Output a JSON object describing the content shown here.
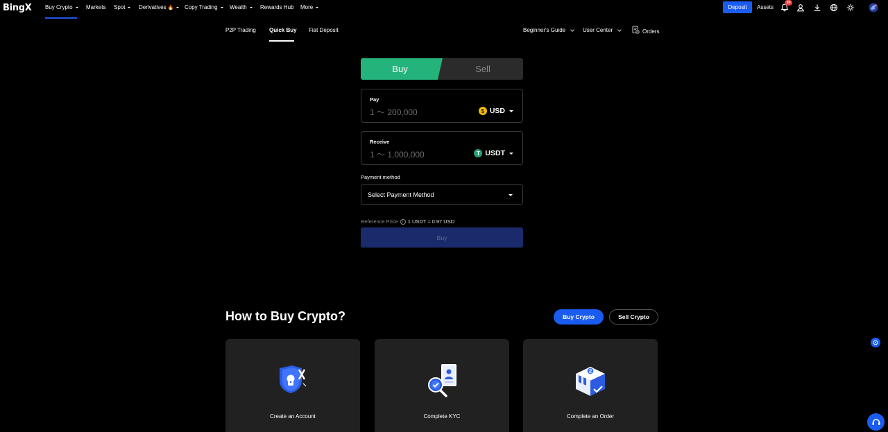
{
  "brand": {
    "logo_text": "BingX"
  },
  "topnav": {
    "items": [
      {
        "label": "Buy Crypto",
        "has_caret": true
      },
      {
        "label": "Markets",
        "has_caret": false
      },
      {
        "label": "Spot",
        "has_caret": true
      },
      {
        "label": "Derivatives",
        "suffix": "🔥",
        "has_caret": true
      },
      {
        "label": "Copy Trading",
        "has_caret": true
      },
      {
        "label": "Wealth",
        "has_caret": true
      },
      {
        "label": "Rewards Hub",
        "has_caret": false
      },
      {
        "label": "More",
        "has_caret": true
      }
    ],
    "active_index": 0,
    "deposit_label": "Deposit",
    "assets_label": "Assets",
    "notification_count": "20",
    "icons": [
      "bell-icon",
      "user-icon",
      "download-icon",
      "globe-icon",
      "theme-sun-icon",
      "avatar"
    ]
  },
  "subnav": {
    "items": [
      "P2P Trading",
      "Quick Buy",
      "Fiat Deposit"
    ],
    "active": "Quick Buy",
    "right": {
      "guide": "Beginner's Guide",
      "user_center": "User Center",
      "orders": "Orders"
    }
  },
  "trade": {
    "buy_tab": "Buy",
    "sell_tab": "Sell",
    "pay": {
      "label": "Pay",
      "placeholder": "1 ～ 200,000",
      "currency": "USD",
      "coin_glyph": "$"
    },
    "receive": {
      "label": "Receive",
      "placeholder": "1 ～ 1,000,000",
      "currency": "USDT",
      "coin_glyph": "T"
    },
    "payment_method": {
      "label": "Payment method",
      "placeholder": "Select Payment Method"
    },
    "reference": {
      "label": "Reference Price",
      "value": "1 USDT ≈ 0.97 USD"
    },
    "submit_label": "Buy"
  },
  "how_to": {
    "title": "How to Buy Crypto?",
    "buy_button": "Buy Crypto",
    "sell_button": "Sell Crypto",
    "steps": [
      "Create an Account",
      "Complete KYC",
      "Complete an Order"
    ]
  },
  "colors": {
    "accent_blue": "#1b5cf0",
    "buy_green": "#25b37c",
    "background": "#000000",
    "card_bg": "#212121"
  }
}
